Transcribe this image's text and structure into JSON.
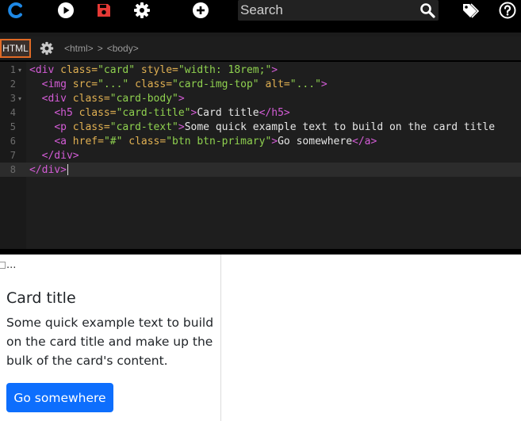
{
  "toolbar": {
    "search_placeholder": "Search",
    "icons": [
      "logo-c-icon",
      "play-icon",
      "save-icon",
      "gear-icon",
      "plus-icon",
      "search-icon",
      "tag-icon",
      "help-icon"
    ],
    "colors": {
      "logo": "#1e88e5",
      "save": "#e53935",
      "icons": "#ffffff"
    }
  },
  "editor": {
    "lang_tab": "HTML",
    "breadcrumb": [
      "<html>",
      "<body>"
    ],
    "breadcrumb_separator": ">",
    "active_line": 8,
    "lines": [
      {
        "num": "1",
        "fold": "▾",
        "tokens": [
          {
            "c": "t",
            "v": "<div"
          },
          {
            "c": "a",
            "v": " class="
          },
          {
            "c": "s",
            "v": "\"card\""
          },
          {
            "c": "a",
            "v": " style="
          },
          {
            "c": "s",
            "v": "\"width: 18rem;\""
          },
          {
            "c": "t",
            "v": ">"
          }
        ]
      },
      {
        "num": "2",
        "fold": "",
        "tokens": [
          {
            "c": "p",
            "v": "  "
          },
          {
            "c": "t",
            "v": "<img"
          },
          {
            "c": "a",
            "v": " src="
          },
          {
            "c": "s",
            "v": "\"...\""
          },
          {
            "c": "a",
            "v": " class="
          },
          {
            "c": "s",
            "v": "\"card-img-top\""
          },
          {
            "c": "a",
            "v": " alt="
          },
          {
            "c": "s",
            "v": "\"...\""
          },
          {
            "c": "t",
            "v": ">"
          }
        ]
      },
      {
        "num": "3",
        "fold": "▾",
        "tokens": [
          {
            "c": "p",
            "v": "  "
          },
          {
            "c": "t",
            "v": "<div"
          },
          {
            "c": "a",
            "v": " class="
          },
          {
            "c": "s",
            "v": "\"card-body\""
          },
          {
            "c": "t",
            "v": ">"
          }
        ]
      },
      {
        "num": "4",
        "fold": "",
        "tokens": [
          {
            "c": "p",
            "v": "    "
          },
          {
            "c": "t",
            "v": "<h5"
          },
          {
            "c": "a",
            "v": " class="
          },
          {
            "c": "s",
            "v": "\"card-title\""
          },
          {
            "c": "t",
            "v": ">"
          },
          {
            "c": "p",
            "v": "Card title"
          },
          {
            "c": "t",
            "v": "</h5>"
          }
        ]
      },
      {
        "num": "5",
        "fold": "",
        "tokens": [
          {
            "c": "p",
            "v": "    "
          },
          {
            "c": "t",
            "v": "<p"
          },
          {
            "c": "a",
            "v": " class="
          },
          {
            "c": "s",
            "v": "\"card-text\""
          },
          {
            "c": "t",
            "v": ">"
          },
          {
            "c": "p",
            "v": "Some quick example text to build on the card title"
          }
        ]
      },
      {
        "num": "6",
        "fold": "",
        "tokens": [
          {
            "c": "p",
            "v": "    "
          },
          {
            "c": "t",
            "v": "<a"
          },
          {
            "c": "a",
            "v": " href="
          },
          {
            "c": "s",
            "v": "\"#\""
          },
          {
            "c": "a",
            "v": " class="
          },
          {
            "c": "s",
            "v": "\"btn btn-primary\""
          },
          {
            "c": "t",
            "v": ">"
          },
          {
            "c": "p",
            "v": "Go somewhere"
          },
          {
            "c": "t",
            "v": "</a>"
          }
        ]
      },
      {
        "num": "7",
        "fold": "",
        "tokens": [
          {
            "c": "p",
            "v": "  "
          },
          {
            "c": "t",
            "v": "</div>"
          }
        ]
      },
      {
        "num": "8",
        "fold": "",
        "tokens": [
          {
            "c": "t",
            "v": "</div>"
          }
        ]
      }
    ]
  },
  "preview": {
    "img_alt": "...",
    "card_title": "Card title",
    "card_text": "Some quick example text to build on the card title and make up the bulk of the card's content.",
    "button_label": "Go somewhere",
    "button_color": "#0d6efd"
  }
}
